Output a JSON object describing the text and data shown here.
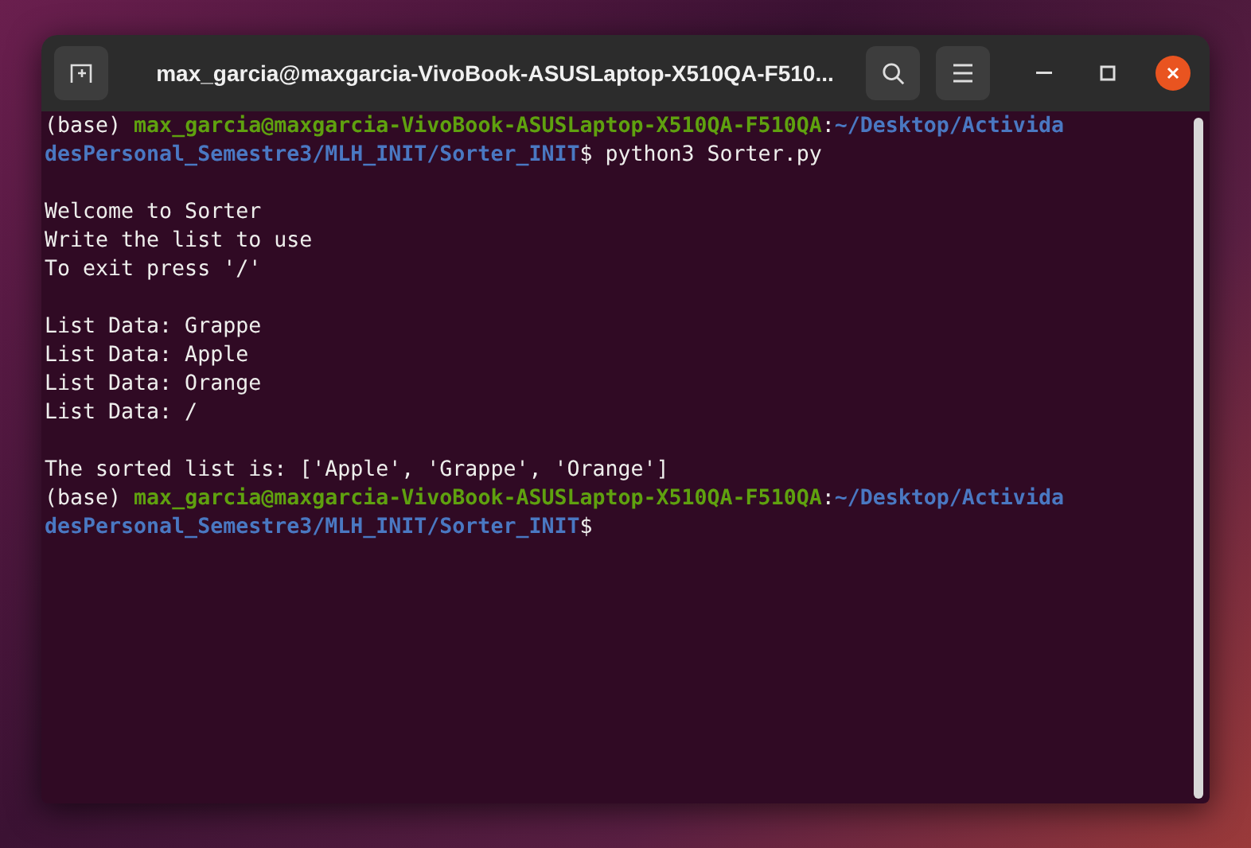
{
  "window": {
    "title": "max_garcia@maxgarcia-VivoBook-ASUSLaptop-X510QA-F510..."
  },
  "terminal": {
    "lines": [
      {
        "kind": "text",
        "segments": [
          {
            "kind": "plain",
            "text": "(base) "
          },
          {
            "kind": "user",
            "text": "max_garcia@maxgarcia-VivoBook-ASUSLaptop-X510QA-F510QA"
          },
          {
            "kind": "plain",
            "text": ":"
          },
          {
            "kind": "path",
            "text": "~/Desktop/Activida"
          }
        ]
      },
      {
        "kind": "text",
        "segments": [
          {
            "kind": "path",
            "text": "desPersonal_Semestre3/MLH_INIT/Sorter_INIT"
          },
          {
            "kind": "plain",
            "text": "$ python3 Sorter.py"
          }
        ]
      },
      {
        "kind": "blank"
      },
      {
        "kind": "text",
        "segments": [
          {
            "kind": "plain",
            "text": "Welcome to Sorter"
          }
        ]
      },
      {
        "kind": "text",
        "segments": [
          {
            "kind": "plain",
            "text": "Write the list to use"
          }
        ]
      },
      {
        "kind": "text",
        "segments": [
          {
            "kind": "plain",
            "text": "To exit press '/'"
          }
        ]
      },
      {
        "kind": "blank"
      },
      {
        "kind": "text",
        "segments": [
          {
            "kind": "plain",
            "text": "List Data: Grappe"
          }
        ]
      },
      {
        "kind": "text",
        "segments": [
          {
            "kind": "plain",
            "text": "List Data: Apple"
          }
        ]
      },
      {
        "kind": "text",
        "segments": [
          {
            "kind": "plain",
            "text": "List Data: Orange"
          }
        ]
      },
      {
        "kind": "text",
        "segments": [
          {
            "kind": "plain",
            "text": "List Data: /"
          }
        ]
      },
      {
        "kind": "blank"
      },
      {
        "kind": "text",
        "segments": [
          {
            "kind": "plain",
            "text": "The sorted list is: ['Apple', 'Grappe', 'Orange']"
          }
        ]
      },
      {
        "kind": "text",
        "segments": [
          {
            "kind": "plain",
            "text": "(base) "
          },
          {
            "kind": "user",
            "text": "max_garcia@maxgarcia-VivoBook-ASUSLaptop-X510QA-F510QA"
          },
          {
            "kind": "plain",
            "text": ":"
          },
          {
            "kind": "path",
            "text": "~/Desktop/Activida"
          }
        ]
      },
      {
        "kind": "text",
        "segments": [
          {
            "kind": "path",
            "text": "desPersonal_Semestre3/MLH_INIT/Sorter_INIT"
          },
          {
            "kind": "plain",
            "text": "$"
          }
        ]
      }
    ]
  }
}
